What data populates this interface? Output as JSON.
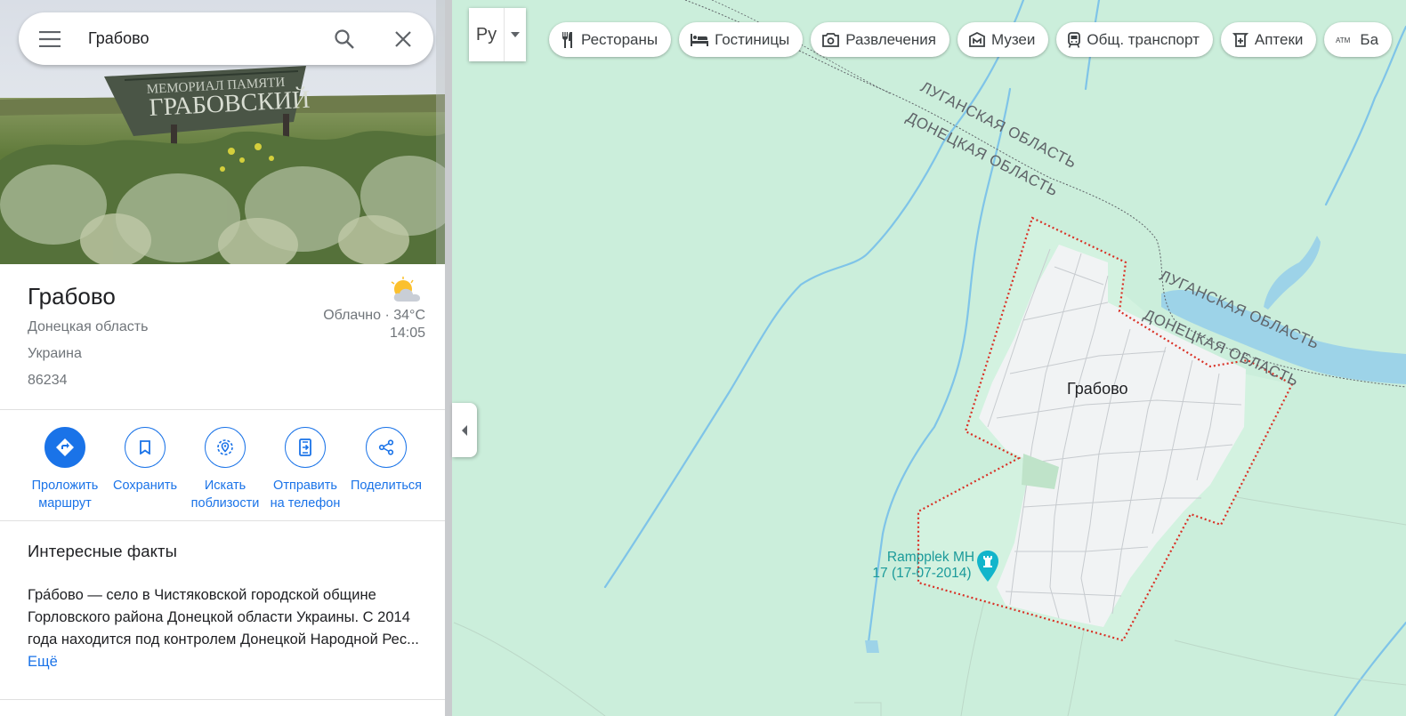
{
  "search": {
    "query": "Грабово"
  },
  "hero_photo": {
    "sign_line1": "МЕМОРИАЛ ПАМЯТИ",
    "sign_line2": "ГРАБОВСКИЙ"
  },
  "place": {
    "title": "Грабово",
    "region": "Донецкая область",
    "country": "Украина",
    "postal_code": "86234"
  },
  "weather": {
    "condition_temp": "Облачно · 34°C",
    "time": "14:05",
    "icon": "partly-cloudy-icon"
  },
  "actions": [
    {
      "line1": "Проложить",
      "line2": "маршрут",
      "icon": "directions-icon"
    },
    {
      "line1": "Сохранить",
      "line2": "",
      "icon": "bookmark-icon"
    },
    {
      "line1": "Искать",
      "line2": "поблизости",
      "icon": "nearby-icon"
    },
    {
      "line1": "Отправить",
      "line2": "на телефон",
      "icon": "send-to-phone-icon"
    },
    {
      "line1": "Поделиться",
      "line2": "",
      "icon": "share-icon"
    }
  ],
  "facts": {
    "heading": "Интересные факты",
    "text": "Гра́бово — село в Чистяковской городской общине Горловского района Донецкой области Украины. С 2014 года находится под контролем Донецкой Народной Рес...",
    "more_label": "Ещё"
  },
  "map_controls": {
    "language_label": "Ру"
  },
  "chips": [
    {
      "label": "Рестораны",
      "icon": "restaurant-icon"
    },
    {
      "label": "Гостиницы",
      "icon": "hotel-icon"
    },
    {
      "label": "Развлечения",
      "icon": "camera-icon"
    },
    {
      "label": "Музеи",
      "icon": "museum-icon"
    },
    {
      "label": "Общ. транспорт",
      "icon": "transit-icon"
    },
    {
      "label": "Аптеки",
      "icon": "pharmacy-icon"
    },
    {
      "label": "Ба",
      "icon": "atm-icon"
    }
  ],
  "map": {
    "town_label": "Грабово",
    "border_labels": [
      "ЛУГАНСКАЯ ОБЛАСТЬ",
      "ДОНЕЦКАЯ ОБЛАСТЬ",
      "ЛУГАНСКАЯ ОБЛАСТЬ",
      "ДОНЕЦКАЯ ОБЛАСТЬ"
    ],
    "poi": {
      "line1": "Rampplek MH",
      "line2": "17 (17-07-2014)",
      "icon": "memorial-icon"
    },
    "colors": {
      "land": "#cbeedb",
      "town": "#f1f3f4",
      "water": "#9dd3e8",
      "boundary": "#d93025",
      "river": "#7fc4e8"
    }
  },
  "colors": {
    "accent": "#1a73e8"
  }
}
